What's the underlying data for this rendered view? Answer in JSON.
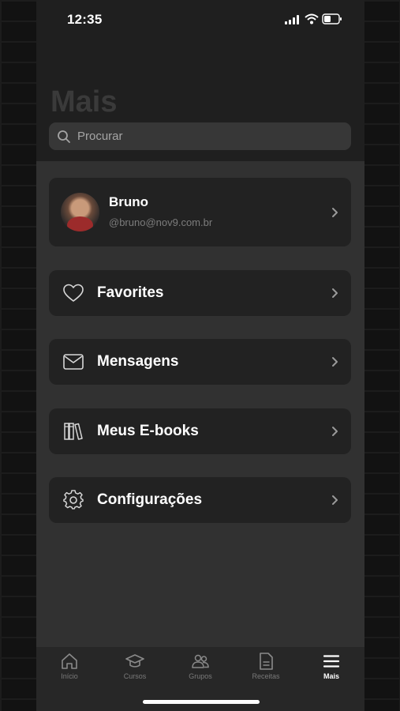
{
  "status_bar": {
    "time": "12:35"
  },
  "header": {
    "title": "Mais"
  },
  "search": {
    "placeholder": "Procurar"
  },
  "profile": {
    "name": "Bruno",
    "email": "@bruno@nov9.com.br"
  },
  "menu": [
    {
      "label": "Favorites",
      "icon": "heart-icon"
    },
    {
      "label": "Mensagens",
      "icon": "envelope-icon"
    },
    {
      "label": "Meus E-books",
      "icon": "books-icon"
    },
    {
      "label": "Configurações",
      "icon": "gear-icon"
    }
  ],
  "tabbar": {
    "items": [
      {
        "label": "Início",
        "icon": "home-icon"
      },
      {
        "label": "Cursos",
        "icon": "graduation-cap-icon"
      },
      {
        "label": "Grupos",
        "icon": "users-icon"
      },
      {
        "label": "Receitas",
        "icon": "document-icon"
      },
      {
        "label": "Mais",
        "icon": "menu-icon"
      }
    ],
    "active": "Mais"
  },
  "colors": {
    "background": "#313131",
    "card": "#222222",
    "text": "#ffffff",
    "muted": "#7c7c7c"
  }
}
